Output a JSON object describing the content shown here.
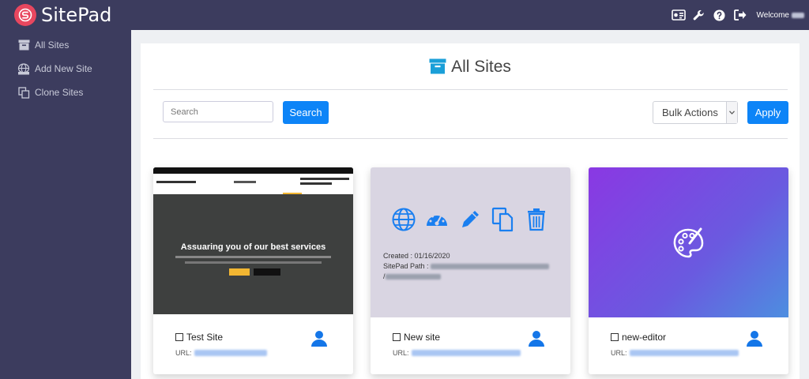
{
  "app": {
    "name": "SitePad",
    "welcome": "Welcome"
  },
  "sidebar": {
    "items": [
      {
        "label": "All Sites",
        "icon": "archive-icon"
      },
      {
        "label": "Add New Site",
        "icon": "globe-icon"
      },
      {
        "label": "Clone Sites",
        "icon": "copy-icon"
      }
    ]
  },
  "topbar": {
    "icons": [
      "dashboard-card-icon",
      "wrench-icon",
      "help-icon",
      "logout-icon"
    ]
  },
  "main": {
    "title": "All Sites",
    "search": {
      "placeholder": "Search",
      "button": "Search"
    },
    "bulk": {
      "selected": "Bulk Actions",
      "apply": "Apply"
    }
  },
  "cards": [
    {
      "name": "Test Site",
      "url_label": "URL:",
      "preview": {
        "hero_title": "Assuaring you of our best services"
      }
    },
    {
      "name": "New site",
      "url_label": "URL:",
      "preview": {
        "created": "Created : 01/16/2020",
        "path_label": "SitePad Path :"
      }
    },
    {
      "name": "new-editor",
      "url_label": "URL:"
    }
  ],
  "colors": {
    "accent": "#0d84f7",
    "brand": "#e8475f",
    "sidebar": "#3c3c5e"
  }
}
